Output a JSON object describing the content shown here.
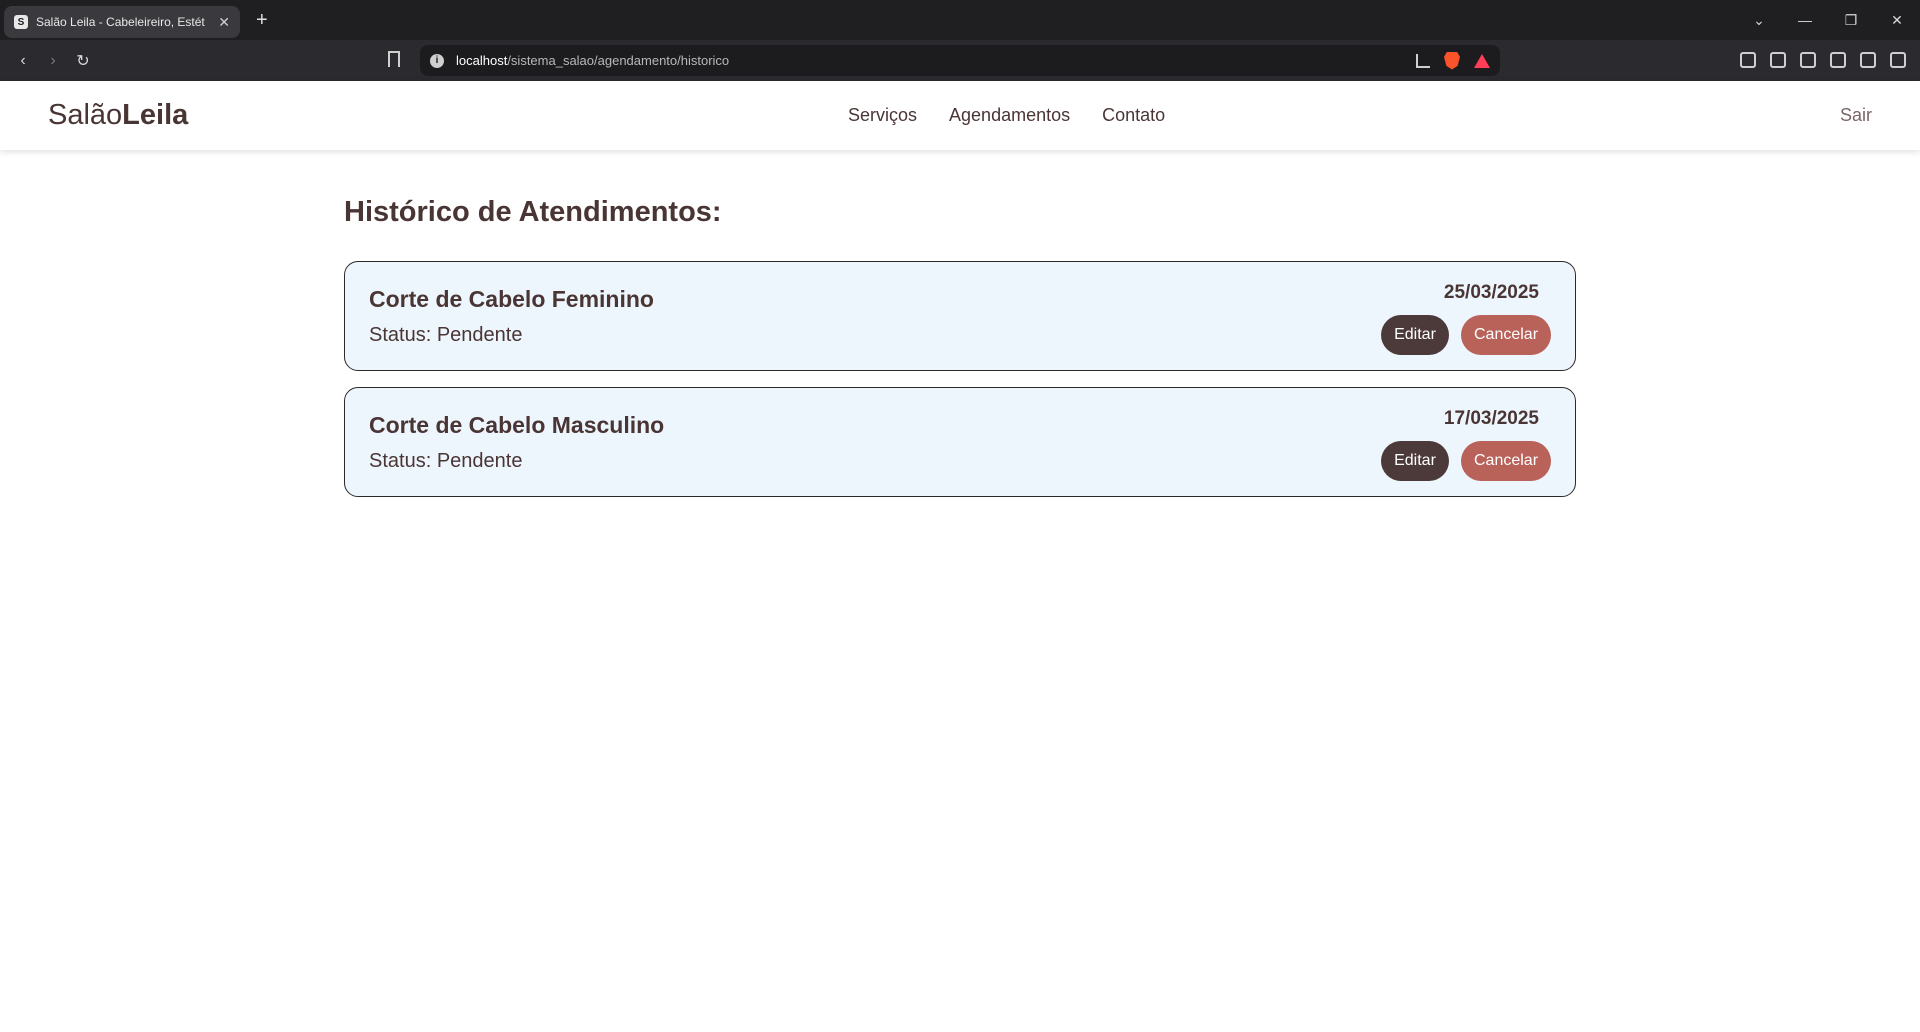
{
  "browser": {
    "tab_title": "Salão Leila - Cabeleireiro, Estét",
    "url_host": "localhost",
    "url_path": "/sistema_salao/agendamento/historico"
  },
  "header": {
    "logo_regular": "Salão",
    "logo_bold": "Leila",
    "nav": [
      "Serviços",
      "Agendamentos",
      "Contato"
    ],
    "logout_label": "Sair"
  },
  "main": {
    "title": "Histórico de Atendimentos:",
    "appointments": [
      {
        "service": "Corte de Cabelo Feminino",
        "status": "Status: Pendente",
        "date": "25/03/2025",
        "edit_label": "Editar",
        "cancel_label": "Cancelar"
      },
      {
        "service": "Corte de Cabelo Masculino",
        "status": "Status: Pendente",
        "date": "17/03/2025",
        "edit_label": "Editar",
        "cancel_label": "Cancelar"
      }
    ]
  },
  "colors": {
    "brand_text": "#4a3535",
    "card_bg": "#eef6fd",
    "edit_button": "#4c3a3a",
    "cancel_button": "#b8625a"
  }
}
